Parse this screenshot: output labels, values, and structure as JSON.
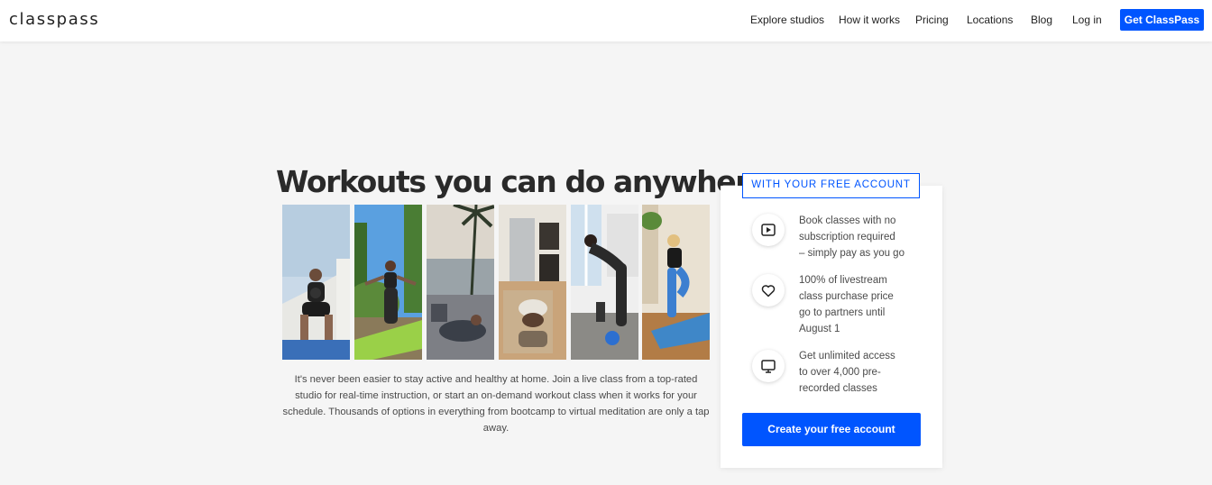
{
  "brand": {
    "logo_text": "classpass",
    "accent_color": "#0055ff"
  },
  "nav": {
    "items": [
      "Explore studios",
      "How it works",
      "Pricing",
      "Locations",
      "Blog",
      "Log in"
    ],
    "cta_label": "Get ClassPass"
  },
  "hero": {
    "headline": "Workouts you can do anywhere",
    "description": "It's never been easier to stay active and healthy at home. Join a live class from a top-rated studio for real-time instruction, or start an on-demand workout class when it works for your schedule. Thousands of options in everything from bootcamp to virtual meditation are only a tap away.",
    "photos": [
      {
        "icon": "workout-photo-squat-kettlebell"
      },
      {
        "icon": "workout-photo-yoga-outdoor"
      },
      {
        "icon": "workout-photo-stretch-palms"
      },
      {
        "icon": "workout-photo-floor-stretch-kitchen"
      },
      {
        "icon": "workout-photo-dumbbell-row"
      },
      {
        "icon": "workout-photo-balance-pose"
      }
    ]
  },
  "card": {
    "badge": "WITH YOUR FREE ACCOUNT",
    "features": [
      {
        "icon": "play-icon",
        "lines": [
          "Book classes with no",
          "subscription required",
          "– simply pay as you go"
        ]
      },
      {
        "icon": "heart-icon",
        "lines": [
          "100% of livestream",
          "class purchase price",
          "go to partners until",
          "August 1"
        ]
      },
      {
        "icon": "monitor-icon",
        "lines": [
          "Get unlimited access",
          "to over 4,000 pre-",
          "recorded classes"
        ]
      }
    ],
    "cta_label": "Create your free account"
  }
}
